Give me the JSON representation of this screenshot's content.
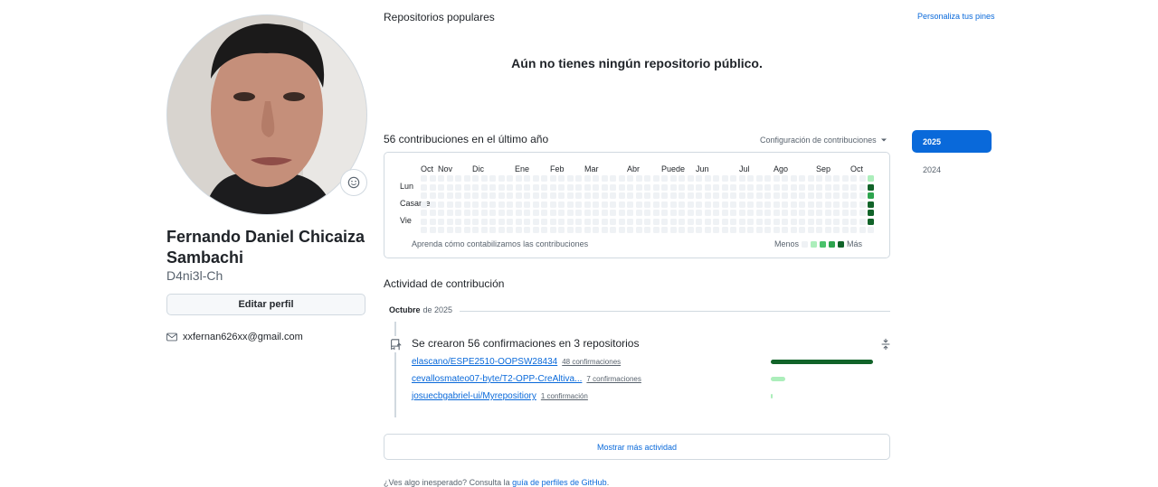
{
  "profile": {
    "full_name": "Fernando Daniel Chicaiza Sambachi",
    "username": "D4ni3l-Ch",
    "edit_label": "Editar perfil",
    "email": "xxfernan626xx@gmail.com",
    "avatar_alt": "avatar",
    "status_icon": "smiley-icon"
  },
  "popular": {
    "title": "Repositorios populares",
    "customize_link": "Personaliza tus pines",
    "empty_message": "Aún no tienes ningún repositorio público."
  },
  "contributions": {
    "title": "56 contribuciones en el último año",
    "settings_label": "Configuración de contribuciones",
    "months": [
      "Oct",
      "Nov",
      "Dic",
      "Ene",
      "Feb",
      "Mar",
      "Abr",
      "Puede",
      "Jun",
      "Jul",
      "Ago",
      "Sep",
      "Oct"
    ],
    "day_labels": [
      "Lun",
      "Casarse",
      "Vie"
    ],
    "learn_text": "Aprenda cómo contabilizamos las contribuciones",
    "legend_less": "Menos",
    "legend_more": "Más",
    "level_colors": [
      "#eff2f5",
      "#aceebb",
      "#4ac26b",
      "#2da44e",
      "#116329"
    ],
    "active_week_levels": [
      [
        0,
        0,
        0,
        0,
        0,
        0,
        0
      ],
      [
        1,
        4,
        3,
        4,
        4,
        4,
        0
      ]
    ]
  },
  "years": {
    "selected": "2025",
    "other": "2024"
  },
  "activity": {
    "title": "Actividad de contribución",
    "month": "Octubre",
    "year_suffix": "de 2025",
    "commits_heading": "Se crearon 56 confirmaciones en 3 repositorios",
    "repos": [
      {
        "name": "elascano/ESPE2510-OOPSW28434",
        "count": "48 confirmaciones",
        "fraction": 1.0,
        "color": "#116329"
      },
      {
        "name": "cevallosmateo07-byte/T2-OPP-CreAltiva...",
        "count": "7 confirmaciones",
        "fraction": 0.146,
        "color": "#aceebb"
      },
      {
        "name": "josuecbgabriel-ui/Myrepositiory",
        "count": "1 confirmación",
        "fraction": 0.02,
        "color": "#aceebb"
      }
    ],
    "show_more": "Mostrar más actividad"
  },
  "footer": {
    "prefix": "¿Ves algo inesperado? Consulta la",
    "link": "guía de perfiles de GitHub",
    "suffix": "."
  }
}
